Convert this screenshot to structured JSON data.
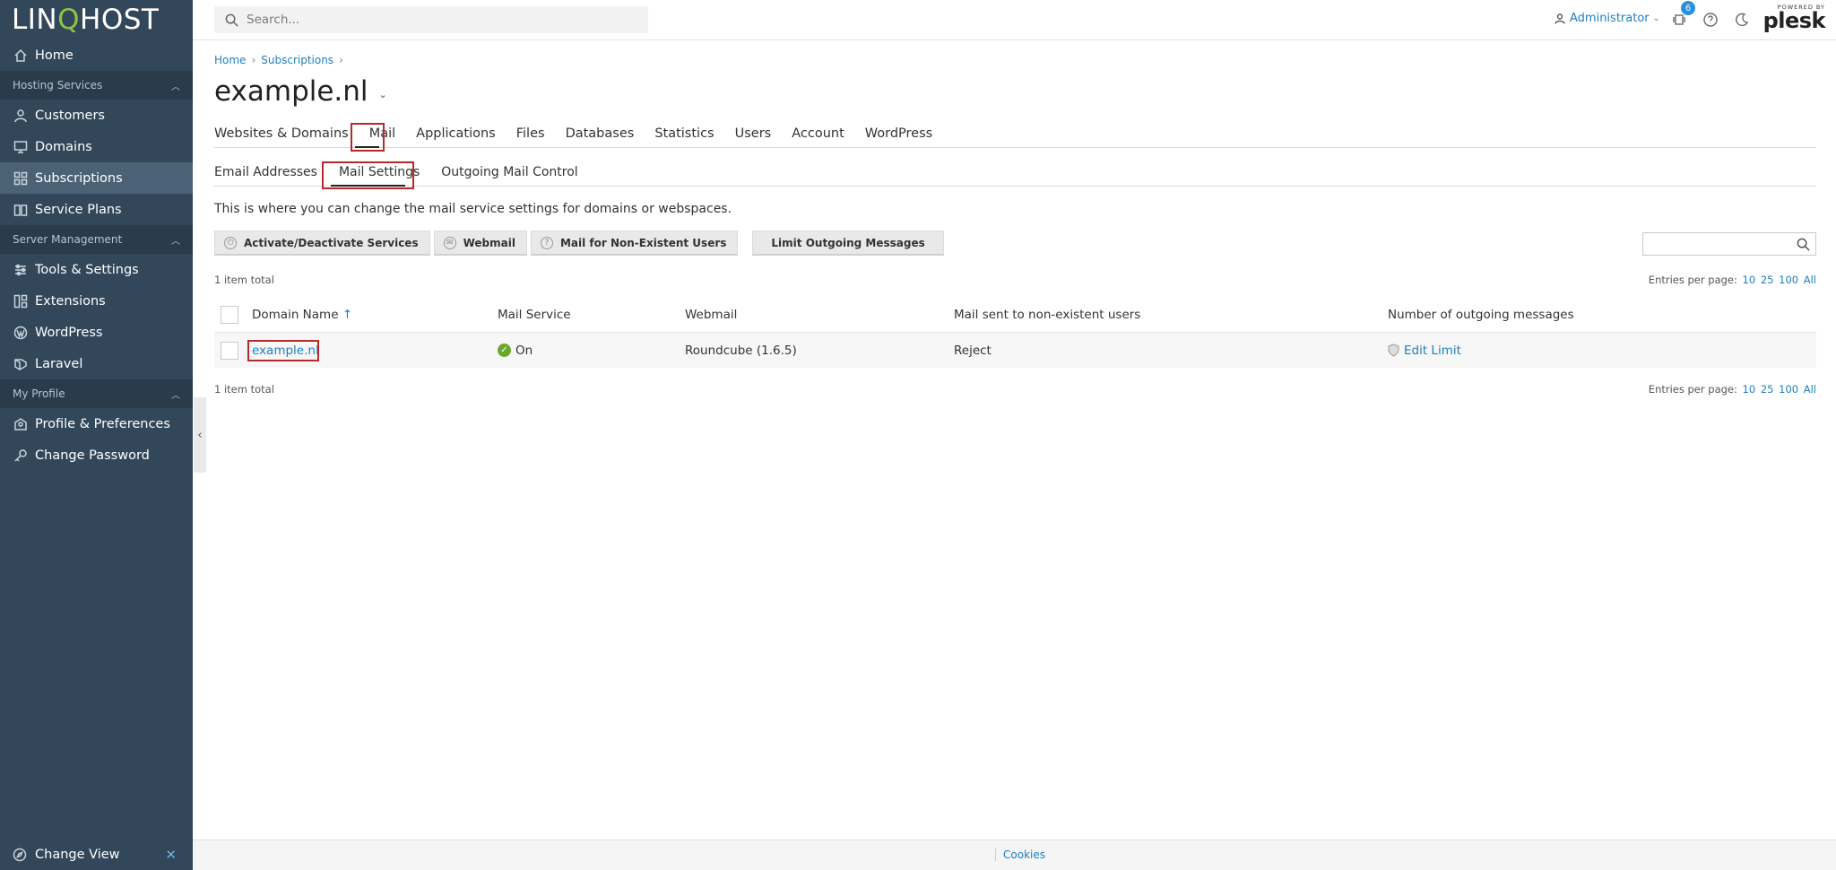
{
  "brand": {
    "logo_left": "LIN",
    "logo_q": "Q",
    "logo_right": "HOST"
  },
  "sidebar": {
    "items_top": [
      {
        "label": "Home",
        "icon": "home-icon"
      }
    ],
    "section_hosting": "Hosting Services",
    "items_hosting": [
      {
        "label": "Customers",
        "icon": "user-icon"
      },
      {
        "label": "Domains",
        "icon": "monitor-icon"
      },
      {
        "label": "Subscriptions",
        "icon": "grid-icon"
      },
      {
        "label": "Service Plans",
        "icon": "book-icon"
      }
    ],
    "section_server": "Server Management",
    "items_server": [
      {
        "label": "Tools & Settings",
        "icon": "sliders-icon"
      },
      {
        "label": "Extensions",
        "icon": "extensions-icon"
      },
      {
        "label": "WordPress",
        "icon": "wordpress-icon"
      },
      {
        "label": "Laravel",
        "icon": "laravel-icon"
      }
    ],
    "section_profile": "My Profile",
    "items_profile": [
      {
        "label": "Profile & Preferences",
        "icon": "profile-icon"
      },
      {
        "label": "Change Password",
        "icon": "key-icon"
      }
    ],
    "change_view": "Change View"
  },
  "header": {
    "search_placeholder": "Search...",
    "user": "Administrator",
    "notifications_count": "6",
    "powered_by": "POWERED BY",
    "plesk": "plesk"
  },
  "breadcrumb": [
    "Home",
    "Subscriptions"
  ],
  "page_title": "example.nl",
  "tabs": [
    "Websites & Domains",
    "Mail",
    "Applications",
    "Files",
    "Databases",
    "Statistics",
    "Users",
    "Account",
    "WordPress"
  ],
  "active_tab": "Mail",
  "subtabs": [
    "Email Addresses",
    "Mail Settings",
    "Outgoing Mail Control"
  ],
  "active_subtab": "Mail Settings",
  "description": "This is where you can change the mail service settings for domains or webspaces.",
  "toolbar": [
    "Activate/Deactivate Services",
    "Webmail",
    "Mail for Non-Existent Users",
    "Limit Outgoing Messages"
  ],
  "list": {
    "total": "1 item total",
    "entries_label": "Entries per page:",
    "entries_options": [
      "10",
      "25",
      "100",
      "All"
    ],
    "columns": [
      "Domain Name",
      "Mail Service",
      "Webmail",
      "Mail sent to non-existent users",
      "Number of outgoing messages"
    ],
    "sort_indicator": "↑",
    "rows": [
      {
        "domain": "example.nl",
        "mail_service": "On",
        "webmail": "Roundcube (1.6.5)",
        "non_existent": "Reject",
        "outgoing": "Edit Limit"
      }
    ]
  },
  "footer": {
    "cookies": "Cookies"
  },
  "colors": {
    "sidebar": "#33475a",
    "accent": "#1e7fbf",
    "highlight": "#b52b2b",
    "ok": "#6aa82b"
  }
}
